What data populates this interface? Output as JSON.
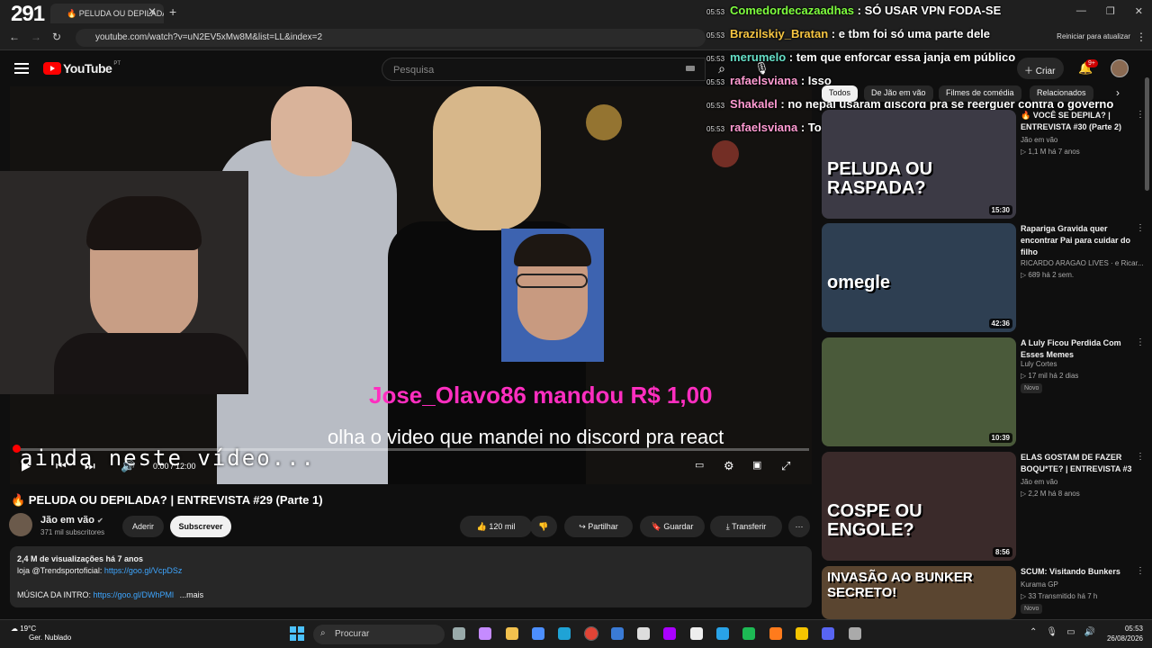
{
  "overlay": {
    "viewer_count": "291"
  },
  "browser": {
    "tab_title": "🔥 PELUDA OU DEPILADA",
    "url": "youtube.com/watch?v=uN2EV5xMw8M&list=LL&index=2",
    "restart_label": "Reiniciar para atualizar"
  },
  "youtube": {
    "logo_text": "YouTube",
    "country": "PT",
    "search_placeholder": "Pesquisa",
    "create_label": "Criar",
    "notif_badge": "9+"
  },
  "chat": [
    {
      "time": "05:53",
      "user": "Comedordecazaadhas",
      "color": "#7fff3f",
      "message": "SÓ USAR VPN FODA-SE"
    },
    {
      "time": "05:53",
      "user": "Brazilskiy_Bratan",
      "color": "#f6c542",
      "message": "e tbm foi só uma parte dele"
    },
    {
      "time": "05:53",
      "user": "merumelo",
      "color": "#66e0c8",
      "message": "tem que enforcar essa janja em público"
    },
    {
      "time": "05:53",
      "user": "rafaelsviana",
      "color": "#ff9bd2",
      "message": "Isso"
    },
    {
      "time": "05:53",
      "user": "Shakalel",
      "color": "#ff9bd2",
      "message": "no nepal usaram discord pra se reerguer contra o governo"
    },
    {
      "time": "05:53",
      "user": "rafaelsviana",
      "color": "#ff9bd2",
      "message": "To fazendo isso"
    }
  ],
  "video": {
    "donation_text": "Jose_Olavo86 mandou R$ 1,00",
    "react_text": "olha o video que mandei no discord pra react",
    "subtitle": "ainda neste vídeo...",
    "time": "0:00 / 12:00",
    "progress": 0
  },
  "info": {
    "title": "🔥 PELUDA OU DEPILADA? | ENTREVISTA #29 (Parte 1)",
    "channel": "Jão em vão",
    "subscribers": "371 mil subscritores",
    "join_label": "Aderir",
    "subscribe_label": "Subscrever",
    "likes": "120 mil",
    "share_label": "Partilhar",
    "save_label": "Guardar",
    "download_label": "Transferir",
    "views": "2,4 M de visualizações  há 7 anos",
    "desc_line1_text": "loja @Trendsportoficial: ",
    "desc_line1_link": "https://goo.gl/VcpDSz",
    "desc_line2_text": "MÚSICA DA INTRO: ",
    "desc_line2_link": "https://goo.gl/DWhPMl",
    "more_label": "...mais"
  },
  "chips": [
    "Todos",
    "De Jão em vão",
    "Filmes de comédia",
    "Relacionados"
  ],
  "sidebar": [
    {
      "title": "🔥 VOCÊ SE DEPILA? | ENTREVISTA #30 (Parte 2)",
      "channel": "Jão em vão",
      "meta": "▷ 1,1 M   há 7 anos",
      "duration": "15:30",
      "badge": "",
      "thumb_text": "PELUDA OU RASPADA?"
    },
    {
      "title": "Rapariga Gravida quer encontrar Pai para cuidar do filho",
      "channel": "RICARDO ARAGAO LIVES · e Ricar...",
      "meta": "▷ 689   há 2 sem.",
      "duration": "42:36",
      "badge": "",
      "thumb_text": "omegle"
    },
    {
      "title": "A Luly Ficou Perdida Com Esses Memes",
      "channel": "Luly Cortes",
      "meta": "▷ 17 mil   há 2 dias",
      "duration": "10:39",
      "badge": "Novo",
      "thumb_text": ""
    },
    {
      "title": "ELAS GOSTAM DE FAZER BOQU*TE? | ENTREVISTA #3",
      "channel": "Jão em vão",
      "meta": "▷ 2,2 M   há 8 anos",
      "duration": "8:56",
      "badge": "",
      "thumb_text": "COSPE OU ENGOLE?"
    },
    {
      "title": "SCUM: Visitando Bunkers",
      "channel": "Kurama GP",
      "meta": "▷ 33   Transmitido há 7 h",
      "duration": "",
      "badge": "Novo",
      "thumb_text": "INVASÃO AO BUNKER SECRETO!"
    }
  ],
  "taskbar": {
    "temp": "19°C",
    "weather": "Ger. Nublado",
    "search_label": "Procurar",
    "time": "05:53",
    "date": "26/08/2026"
  }
}
